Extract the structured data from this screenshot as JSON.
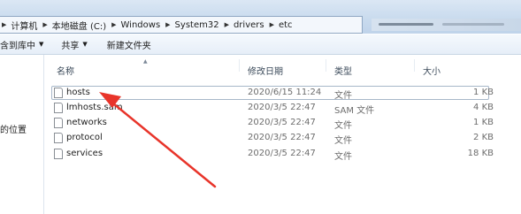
{
  "breadcrumb": [
    {
      "label": "计算机"
    },
    {
      "label": "本地磁盘 (C:)"
    },
    {
      "label": "Windows"
    },
    {
      "label": "System32"
    },
    {
      "label": "drivers"
    },
    {
      "label": "etc"
    }
  ],
  "toolbar": {
    "include_label": "含到库中",
    "share_label": "共享",
    "new_folder_label": "新建文件夹"
  },
  "nav": {
    "item_label": "的位置"
  },
  "columns": {
    "name": "名称",
    "date": "修改日期",
    "type": "类型",
    "size": "大小"
  },
  "files": [
    {
      "name": "hosts",
      "date": "2020/6/15 11:24",
      "type": "文件",
      "size": "1 KB"
    },
    {
      "name": "lmhosts.sam",
      "date": "2020/3/5 22:47",
      "type": "SAM 文件",
      "size": "4 KB"
    },
    {
      "name": "networks",
      "date": "2020/3/5 22:47",
      "type": "文件",
      "size": "1 KB"
    },
    {
      "name": "protocol",
      "date": "2020/3/5 22:47",
      "type": "文件",
      "size": "2 KB"
    },
    {
      "name": "services",
      "date": "2020/3/5 22:47",
      "type": "文件",
      "size": "18 KB"
    }
  ],
  "colors": {
    "annotation_arrow": "#e8342a",
    "selection_border": "#a7b7c9"
  }
}
